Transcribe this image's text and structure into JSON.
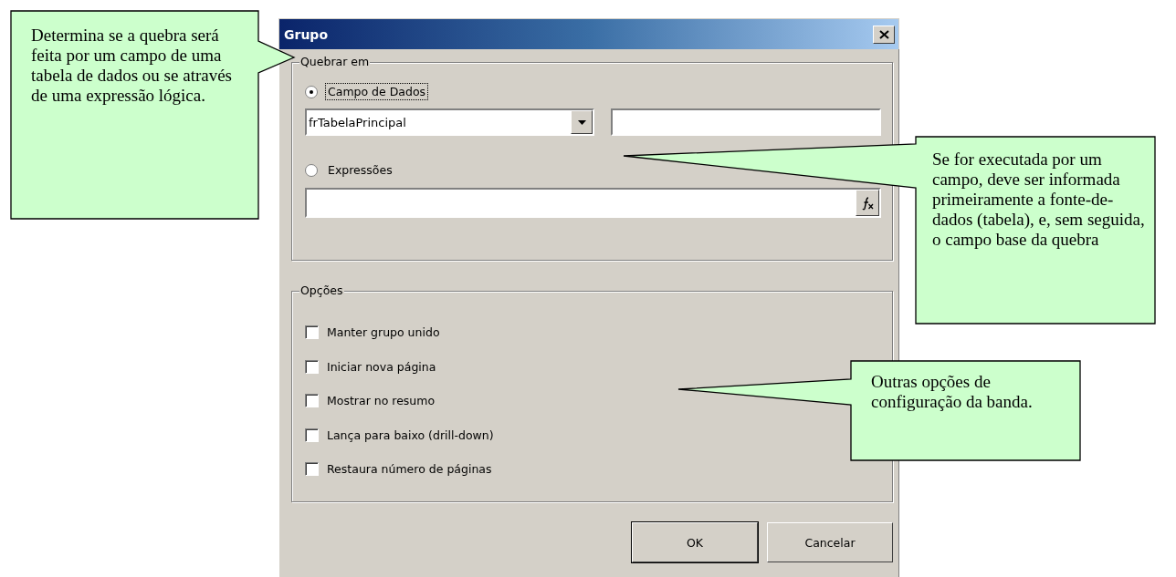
{
  "dialog": {
    "title": "Grupo",
    "break_on": {
      "label": "Quebrar em",
      "field_option": {
        "label": "Campo de Dados",
        "selected": true
      },
      "table_combo": {
        "value": "frTabelaPrincipal"
      },
      "expression_option": {
        "label": "Expressões",
        "selected": false
      }
    },
    "options": {
      "label": "Opções",
      "items": [
        {
          "label": "Manter grupo unido",
          "checked": false
        },
        {
          "label": "Iniciar nova página",
          "checked": false
        },
        {
          "label": "Mostrar no resumo",
          "checked": false
        },
        {
          "label": "Lança para baixo (drill-down)",
          "checked": false
        },
        {
          "label": "Restaura número de páginas",
          "checked": false
        }
      ]
    },
    "buttons": [
      {
        "label": "OK",
        "default": true
      },
      {
        "label": "Cancelar",
        "default": false
      }
    ]
  },
  "callouts": [
    {
      "text": "Determina se a quebra será feita por um campo de uma tabela de dados ou se através de uma expressão lógica."
    },
    {
      "text": "Se for executada por um campo, deve ser informada primeiramente a fonte-de-dados (tabela), e, sem seguida, o campo base da quebra"
    },
    {
      "text": "Outras opções de configuração da banda."
    }
  ]
}
